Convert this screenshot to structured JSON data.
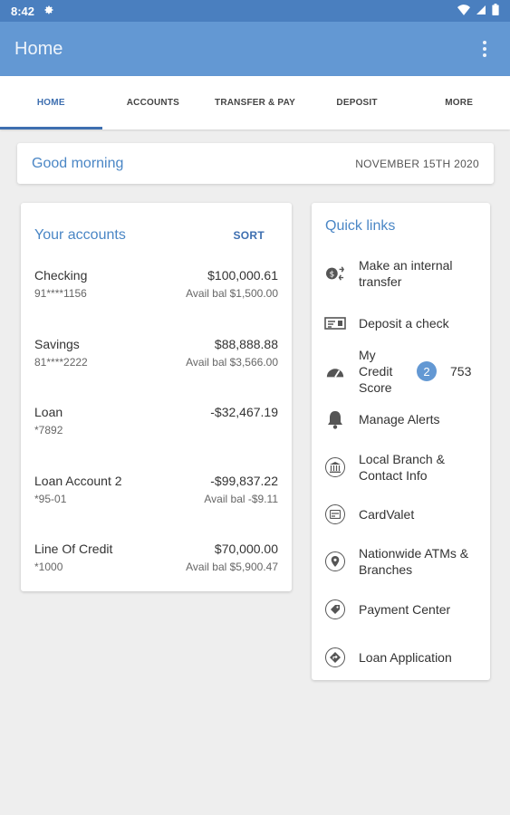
{
  "status_bar": {
    "time": "8:42"
  },
  "app_bar": {
    "title": "Home"
  },
  "tabs": [
    {
      "label": "HOME",
      "active": true
    },
    {
      "label": "ACCOUNTS"
    },
    {
      "label": "TRANSFER & PAY"
    },
    {
      "label": "DEPOSIT"
    },
    {
      "label": "MORE"
    }
  ],
  "greeting": {
    "text": "Good morning",
    "date": "NOVEMBER 15TH 2020"
  },
  "accounts": {
    "title": "Your accounts",
    "sort_label": "SORT",
    "items": [
      {
        "name": "Checking",
        "number": "91****1156",
        "amount": "$100,000.61",
        "avail": "Avail bal $1,500.00"
      },
      {
        "name": "Savings",
        "number": "81****2222",
        "amount": "$88,888.88",
        "avail": "Avail bal $3,566.00"
      },
      {
        "name": "Loan",
        "number": "*7892",
        "amount": "-$32,467.19",
        "avail": ""
      },
      {
        "name": "Loan Account 2",
        "number": "*95-01",
        "amount": "-$99,837.22",
        "avail": "Avail bal -$9.11"
      },
      {
        "name": "Line Of Credit",
        "number": "*1000",
        "amount": "$70,000.00",
        "avail": "Avail bal $5,900.47"
      }
    ]
  },
  "quick_links": {
    "title": "Quick links",
    "items": [
      {
        "label": "Make an internal transfer",
        "icon": "transfer-icon"
      },
      {
        "label": "Deposit a check",
        "icon": "check-deposit-icon"
      },
      {
        "label": "My Credit Score",
        "icon": "gauge-icon",
        "badge": "2",
        "score": "753"
      },
      {
        "label": "Manage Alerts",
        "icon": "bell-icon"
      },
      {
        "label": "Local Branch & Contact Info",
        "icon": "bank-icon"
      },
      {
        "label": "CardValet",
        "icon": "card-icon"
      },
      {
        "label": "Nationwide ATMs & Branches",
        "icon": "location-pin-icon"
      },
      {
        "label": "Payment Center",
        "icon": "tag-icon"
      },
      {
        "label": "Loan Application",
        "icon": "directions-icon"
      }
    ]
  },
  "colors": {
    "app_bar": "#6398d3",
    "status_bar": "#4a7fbf",
    "accent": "#3e6fb0",
    "heading": "#4a86c5"
  }
}
